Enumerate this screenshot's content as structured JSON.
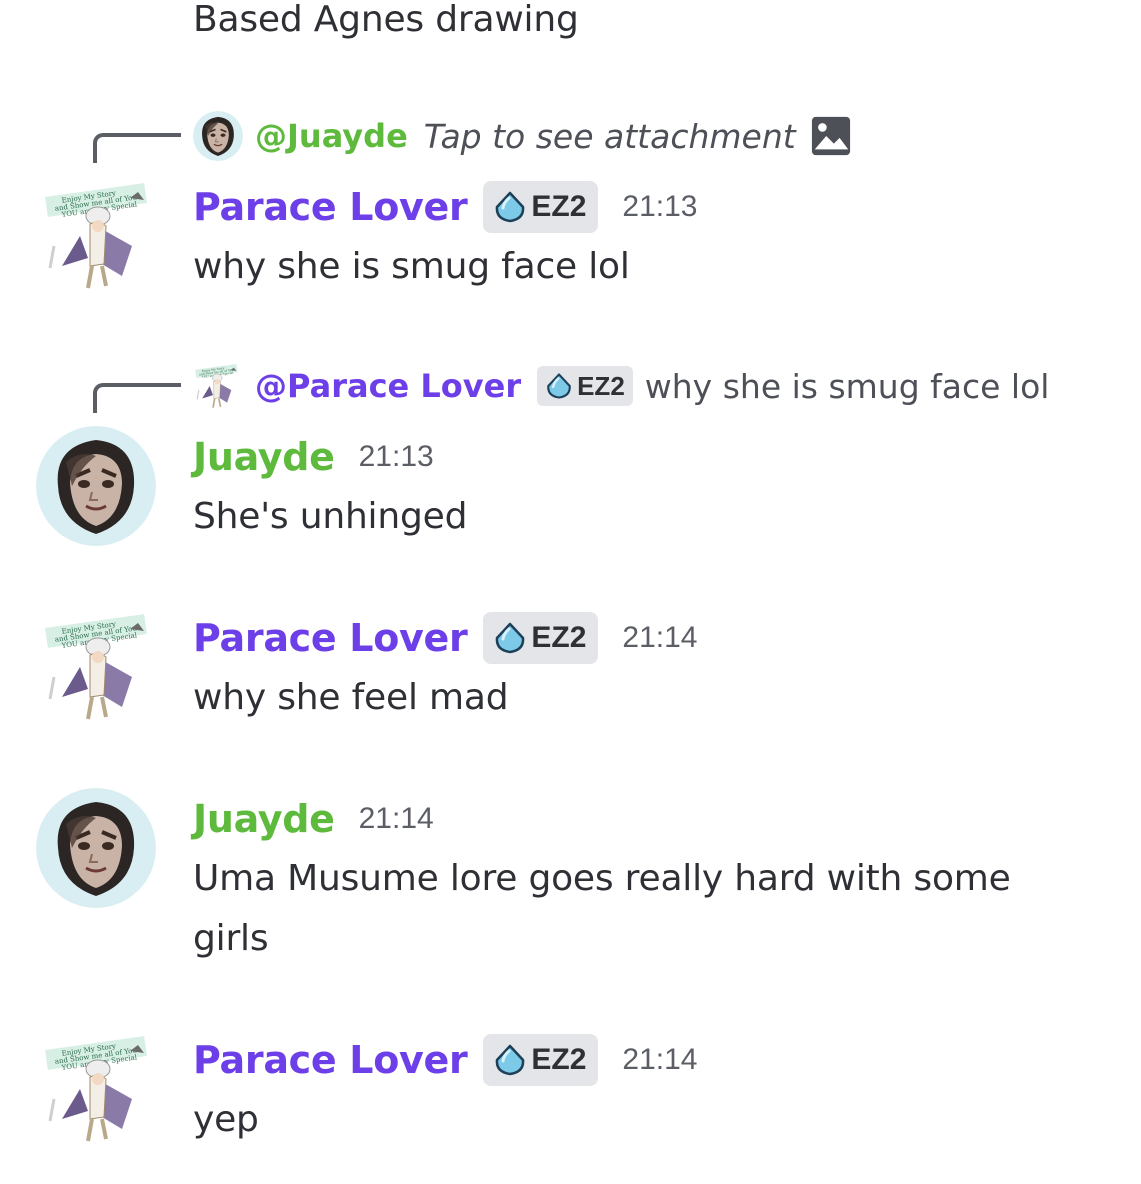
{
  "top_message": {
    "text": "Based Agnes drawing"
  },
  "badge_label": "EZ2",
  "messages": [
    {
      "reply": {
        "mention": "@Juayde",
        "text": "Tap to see attachment"
      },
      "author": "Parace Lover",
      "time": "21:13",
      "text": "why she is smug face lol"
    },
    {
      "reply": {
        "mention": "@Parace Lover",
        "text": "why she is smug face lol"
      },
      "author": "Juayde",
      "time": "21:13",
      "text": "She's unhinged"
    },
    {
      "author": "Parace Lover",
      "time": "21:14",
      "text": "why she feel mad"
    },
    {
      "author": "Juayde",
      "time": "21:14",
      "text": "Uma Musume lore goes really hard with some girls"
    },
    {
      "author": "Parace Lover",
      "time": "21:14",
      "text": "yep"
    }
  ],
  "colors": {
    "parace_name": "#6c3fe8",
    "juayde_name": "#5eba3c",
    "text": "#2e3035",
    "timestamp": "#5c5e66",
    "badge_bg": "#e3e5e8"
  }
}
